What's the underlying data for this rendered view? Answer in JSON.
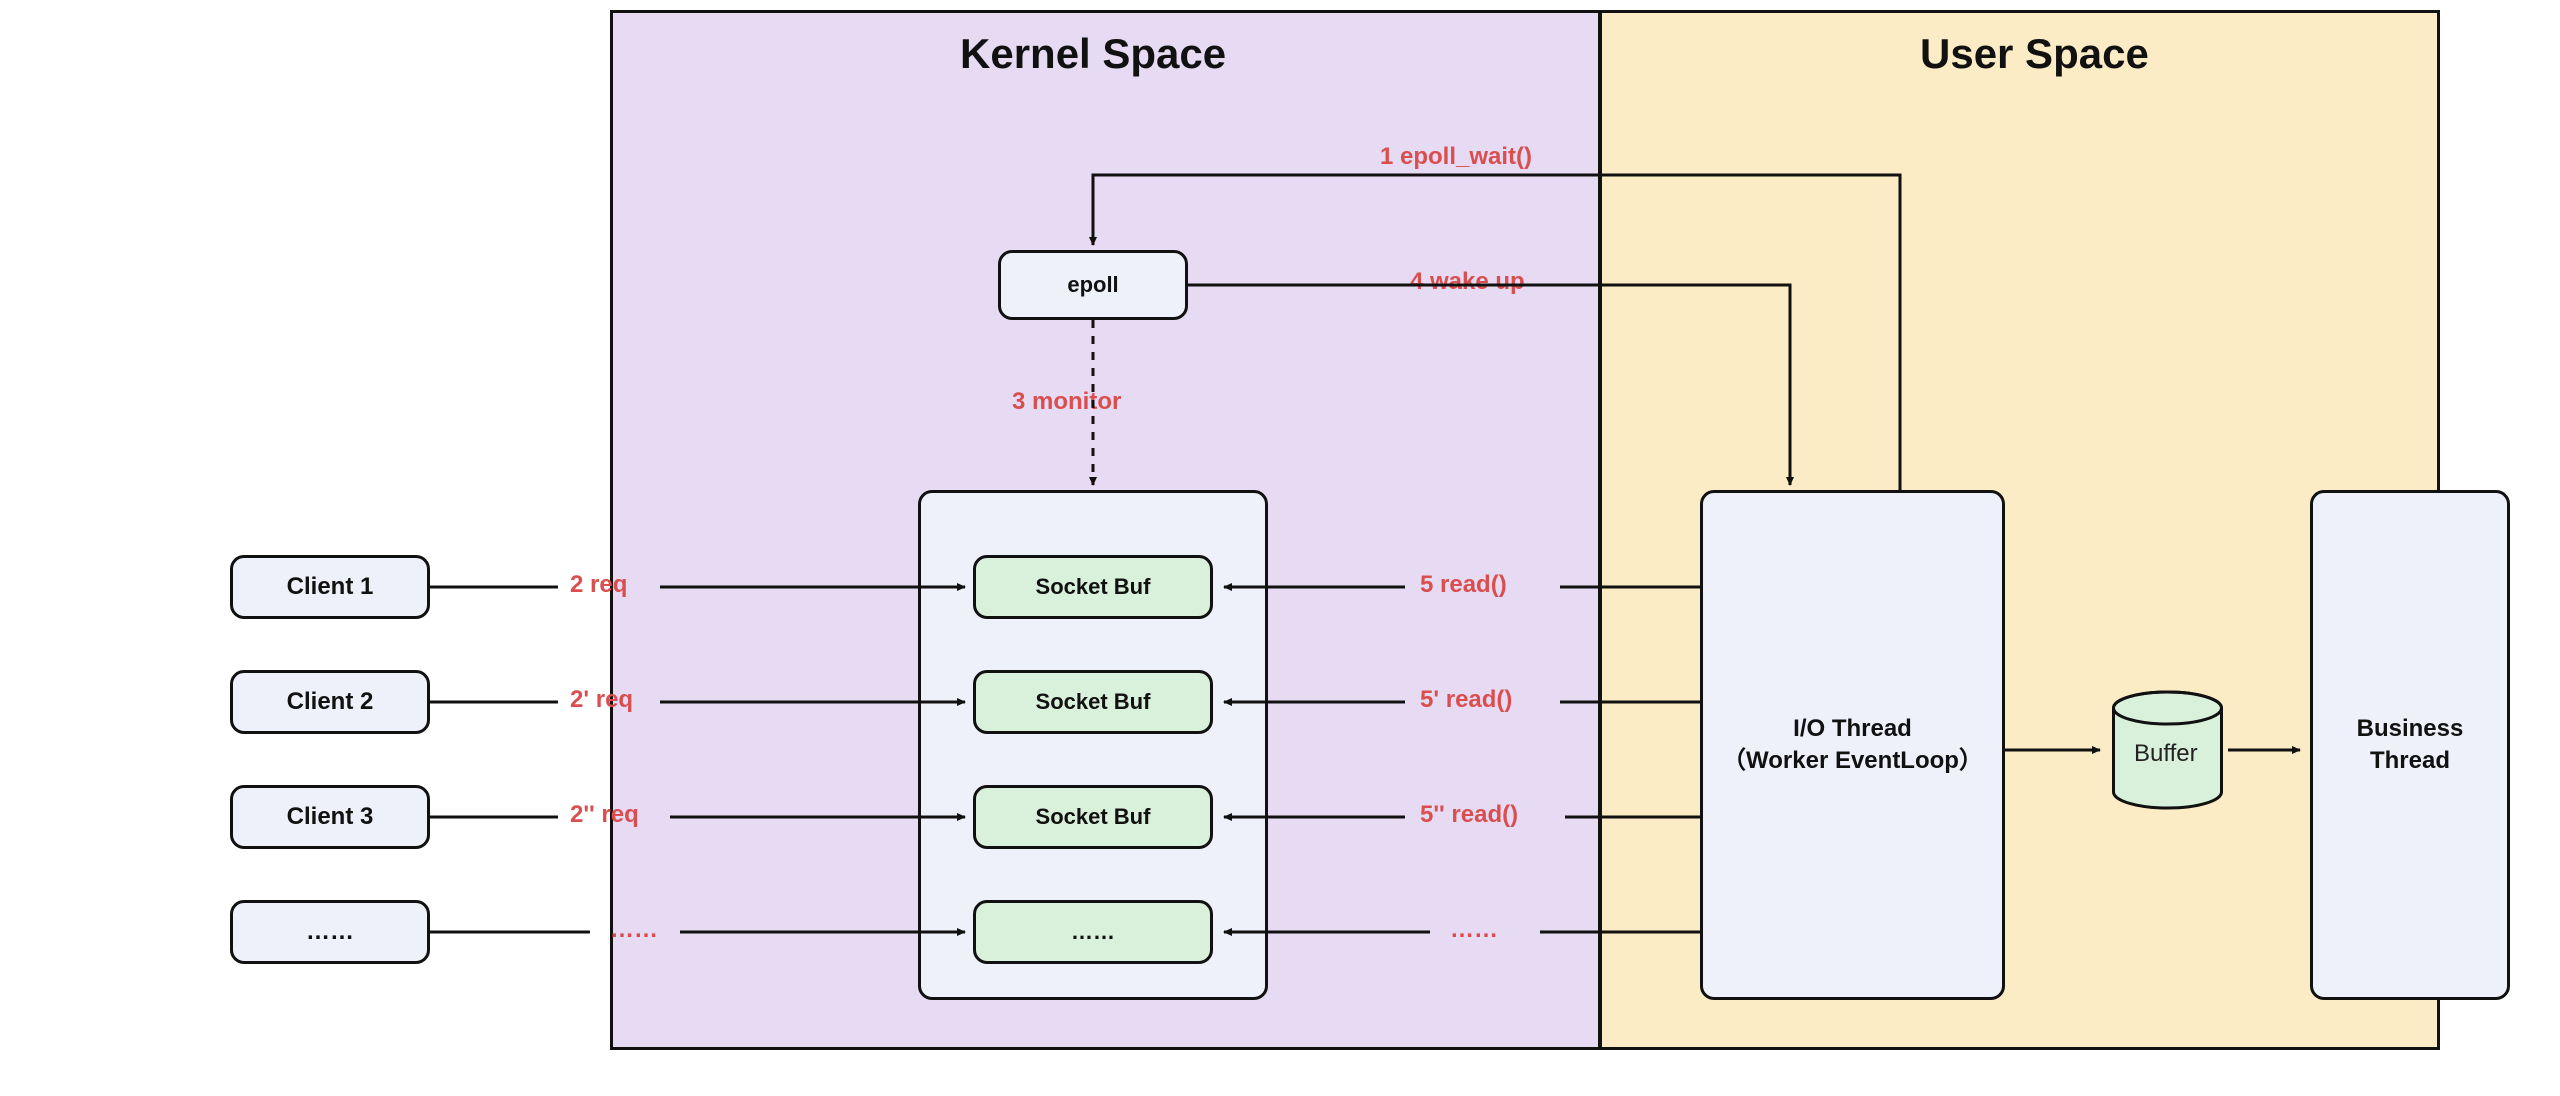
{
  "regions": {
    "kernel_title": "Kernel Space",
    "user_title": "User Space"
  },
  "clients": {
    "c1": "Client 1",
    "c2": "Client 2",
    "c3": "Client 3",
    "c4": "……"
  },
  "epoll": "epoll",
  "socket_container_items": {
    "s1": "Socket Buf",
    "s2": "Socket Buf",
    "s3": "Socket Buf",
    "s4": "……"
  },
  "user": {
    "io_thread_line1": "I/O Thread",
    "io_thread_line2": "（Worker EventLoop）",
    "buffer": "Buffer",
    "business_thread_line1": "Business",
    "business_thread_line2": "Thread"
  },
  "labels": {
    "epoll_wait": "1 epoll_wait()",
    "req1": "2 req",
    "req2": "2' req",
    "req3": "2'' req",
    "req4": "……",
    "monitor": "3 monitor",
    "wakeup": "4 wake up",
    "read1": "5 read()",
    "read2": "5' read()",
    "read3": "5'' read()",
    "read4": "……"
  },
  "colors": {
    "kernel_bg": "#e7dbf4",
    "user_bg": "#fcecc5",
    "node_bg": "#eef0fa",
    "socket_bg": "#d9f0da",
    "accent": "#d94f4f",
    "stroke": "#111111"
  }
}
